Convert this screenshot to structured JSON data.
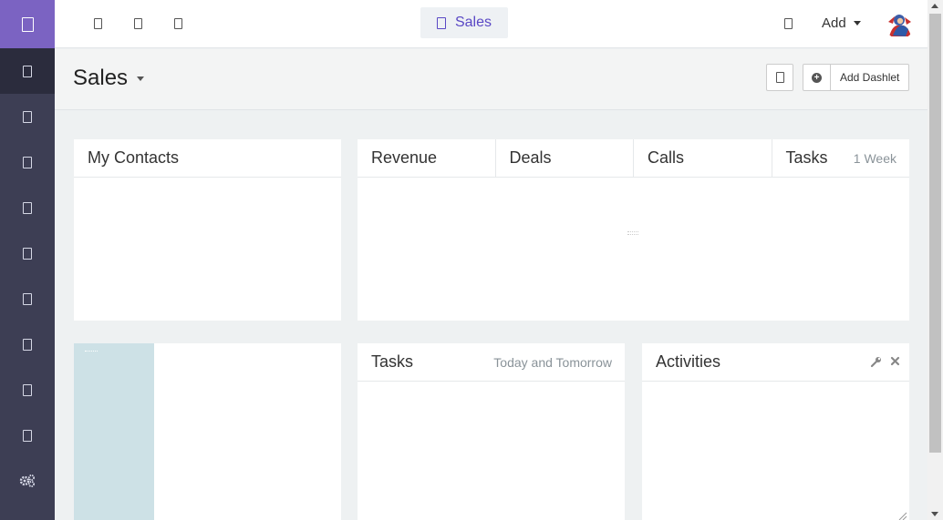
{
  "topbar": {
    "active_tab": "Sales",
    "add_label": "Add"
  },
  "page": {
    "title": "Sales",
    "add_dashlet_label": "Add Dashlet"
  },
  "dashlets": {
    "contacts": {
      "title": "My Contacts"
    },
    "stats": {
      "tabs": [
        "Revenue",
        "Deals",
        "Calls",
        "Tasks"
      ],
      "period": "1 Week"
    },
    "tasks": {
      "title": "Tasks",
      "subtitle": "Today and Tomorrow"
    },
    "activities": {
      "title": "Activities"
    }
  },
  "colors": {
    "sidebar": "#3d3e54",
    "logo_bg": "#7b63c2",
    "accent": "#5a48c5",
    "calendar_bg": "#cde1e6"
  },
  "icons": {
    "sidebar": [
      "home-icon",
      "contacts-icon",
      "accounts-icon",
      "deals-icon",
      "calendar-icon",
      "tasks-icon",
      "documents-icon",
      "reports-icon",
      "mail-icon",
      "settings-icon"
    ]
  }
}
